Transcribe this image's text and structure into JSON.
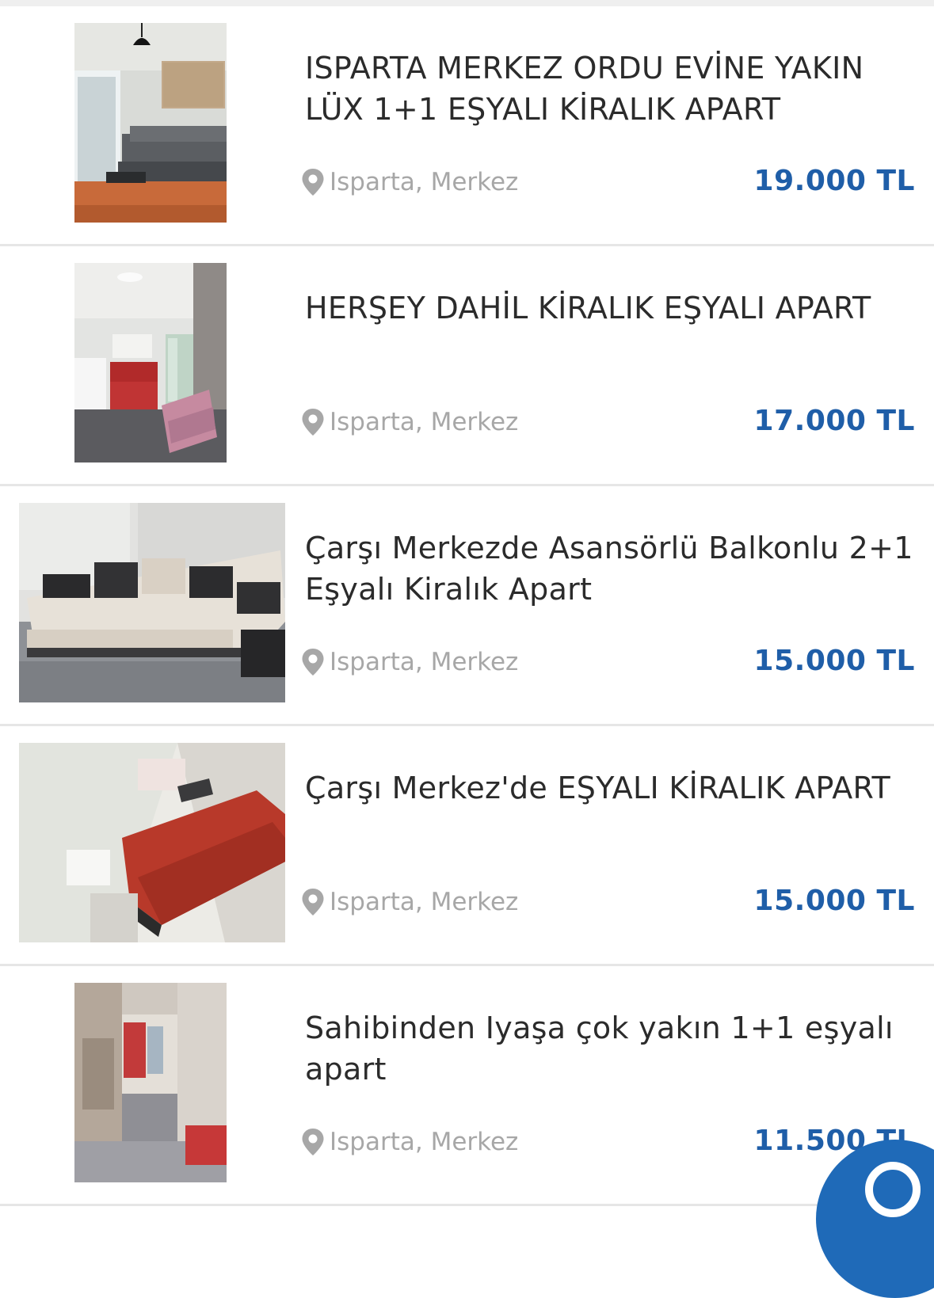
{
  "colors": {
    "price": "#1f5ea8",
    "location": "#a7a7a7",
    "title": "#2b2b2b",
    "fab": "#1f6ab8"
  },
  "listings": [
    {
      "title": "ISPARTA MERKEZ ORDU EVİNE YAKIN LÜX 1+1 EŞYALI KİRALIK APART",
      "location": "Isparta, Merkez",
      "price": "19.000 TL",
      "photo": "living-room-photo"
    },
    {
      "title": "HERŞEY DAHİL KİRALIK EŞYALI APART",
      "location": "Isparta, Merkez",
      "price": "17.000 TL",
      "photo": "kitchen-room-photo"
    },
    {
      "title": "Çarşı Merkezde Asansörlü Balkonlu 2+1 Eşyalı Kiralık Apart",
      "location": "Isparta, Merkez",
      "price": "15.000 TL",
      "photo": "corner-sofa-photo"
    },
    {
      "title": "Çarşı Merkez'de EŞYALI KİRALIK APART",
      "location": "Isparta, Merkez",
      "price": "15.000 TL",
      "photo": "red-sofa-photo"
    },
    {
      "title": "Sahibinden Iyaşa çok yakın 1+1 eşyalı apart",
      "location": "Isparta, Merkez",
      "price": "11.500 TL",
      "photo": "corridor-room-photo"
    }
  ],
  "fab": {
    "icon": "search-icon"
  }
}
